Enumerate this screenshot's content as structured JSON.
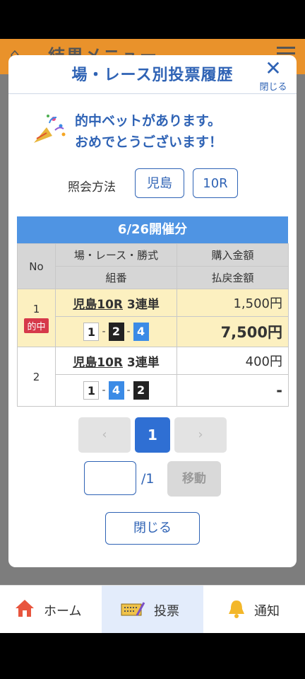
{
  "header": {
    "title": "結果メニュー",
    "home_icon": "home-icon",
    "menu_icon": "hamburger-icon"
  },
  "modal": {
    "title": "場・レース別投票履歴",
    "close_label": "閉じる",
    "congrats_line1": "的中ベットがあります。",
    "congrats_line2": "おめでとうございます！",
    "inquiry_label": "照会方法",
    "inquiry_venue": "児島",
    "inquiry_race": "10R",
    "date_header": "6/26開催分",
    "columns": {
      "no": "No",
      "race": "場・レース・勝式",
      "combo": "組番",
      "buy": "購入金額",
      "payout": "払戻金額"
    },
    "rows": [
      {
        "no": "1",
        "badge": "的中",
        "race": "児島10R",
        "bet_type": "3連単",
        "combo": [
          "1",
          "2",
          "4"
        ],
        "buy": "1,500円",
        "payout": "7,500円"
      },
      {
        "no": "2",
        "race": "児島10R",
        "bet_type": "3連単",
        "combo": [
          "1",
          "4",
          "2"
        ],
        "buy": "400円",
        "payout": "-"
      }
    ],
    "pager": {
      "prev": "‹",
      "current": "1",
      "next": "›",
      "total": "/1",
      "move": "移動"
    },
    "close_button": "閉じる"
  },
  "nav": {
    "home": "ホーム",
    "vote": "投票",
    "notify": "通知"
  },
  "colors": {
    "accent": "#2f63b5",
    "table_header": "#4f94e3",
    "hit_badge": "#d6394a",
    "highlight": "#fcf0c0"
  }
}
